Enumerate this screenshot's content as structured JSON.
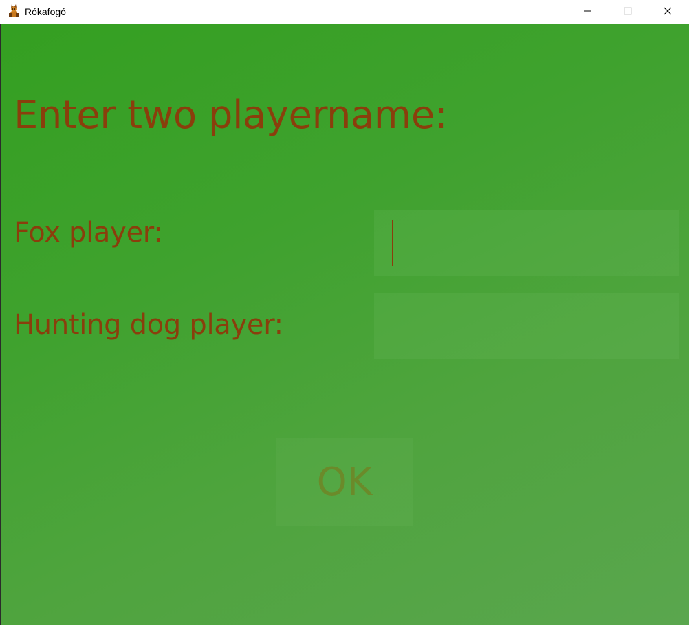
{
  "window": {
    "title": "Rókafogó",
    "app_icon": "fox-app-icon",
    "controls": {
      "minimize_icon": "minimize-icon",
      "maximize_icon": "maximize-icon",
      "close_icon": "close-icon"
    }
  },
  "form": {
    "heading": "Enter two playername:",
    "fox_label": "Fox player:",
    "fox_value": "",
    "dog_label": "Hunting dog player:",
    "dog_value": "",
    "ok_label": "OK"
  },
  "colors": {
    "background_start": "#349f21",
    "background_end": "#5aa64e",
    "text": "#8a3e0c",
    "ok_text": "#6b8a2a"
  }
}
